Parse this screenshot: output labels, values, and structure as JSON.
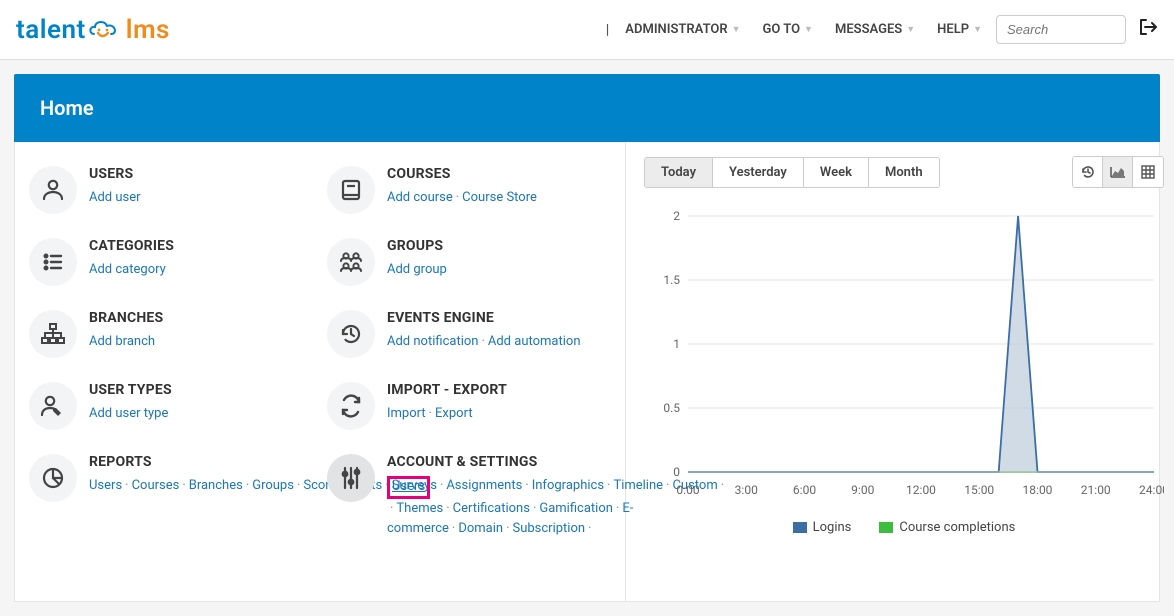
{
  "brand": {
    "left": "talent",
    "right": "lms"
  },
  "topnav": {
    "admin": "ADMINISTRATOR",
    "goto": "GO TO",
    "messages": "MESSAGES",
    "help": "HELP",
    "search_placeholder": "Search",
    "separator": "|"
  },
  "hero": {
    "title": "Home"
  },
  "widgets": {
    "users": {
      "title": "USERS",
      "links": [
        "Add user"
      ]
    },
    "courses": {
      "title": "COURSES",
      "links": [
        "Add course",
        "Course Store"
      ]
    },
    "categories": {
      "title": "CATEGORIES",
      "links": [
        "Add category"
      ]
    },
    "groups": {
      "title": "GROUPS",
      "links": [
        "Add group"
      ]
    },
    "branches": {
      "title": "BRANCHES",
      "links": [
        "Add branch"
      ]
    },
    "events": {
      "title": "EVENTS ENGINE",
      "links": [
        "Add notification",
        "Add automation"
      ]
    },
    "usertypes": {
      "title": "USER TYPES",
      "links": [
        "Add user type"
      ]
    },
    "importexp": {
      "title": "IMPORT - EXPORT",
      "links": [
        "Import",
        "Export"
      ]
    },
    "reports": {
      "title": "REPORTS",
      "links": [
        "Users",
        "Courses",
        "Branches",
        "Groups",
        "Scorm",
        "Tests",
        "Surveys",
        "Assignments",
        "Infographics",
        "Timeline",
        "Custom"
      ]
    },
    "account": {
      "title": "ACCOUNT & SETTINGS",
      "links": [
        "Users",
        "Themes",
        "Certifications",
        "Gamification",
        "E-commerce",
        "Domain",
        "Subscription"
      ],
      "highlighted_index": 0
    }
  },
  "toolbar": {
    "ranges": [
      "Today",
      "Yesterday",
      "Week",
      "Month"
    ],
    "active_range_index": 0,
    "views": [
      "timeline",
      "area",
      "grid"
    ],
    "active_view_index": 1
  },
  "chart_data": {
    "type": "area",
    "x": [
      "0:00",
      "3:00",
      "6:00",
      "9:00",
      "12:00",
      "15:00",
      "18:00",
      "21:00",
      "24:00"
    ],
    "ylim": [
      0,
      2
    ],
    "yticks": [
      0,
      0.5,
      1,
      1.5,
      2
    ],
    "series": [
      {
        "name": "Logins",
        "color": "#3b6ea5",
        "fill": "#aabecf",
        "values": [
          0,
          0,
          0,
          0,
          0,
          0,
          0,
          0,
          0,
          0,
          0,
          0,
          0,
          0,
          0,
          0,
          0,
          2,
          0,
          0,
          0,
          0,
          0,
          0,
          0
        ]
      },
      {
        "name": "Course completions",
        "color": "#3dbd3d",
        "fill": "#3dbd3d",
        "values": [
          0,
          0,
          0,
          0,
          0,
          0,
          0,
          0,
          0,
          0,
          0,
          0,
          0,
          0,
          0,
          0,
          0,
          0,
          0,
          0,
          0,
          0,
          0,
          0,
          0
        ]
      }
    ]
  }
}
